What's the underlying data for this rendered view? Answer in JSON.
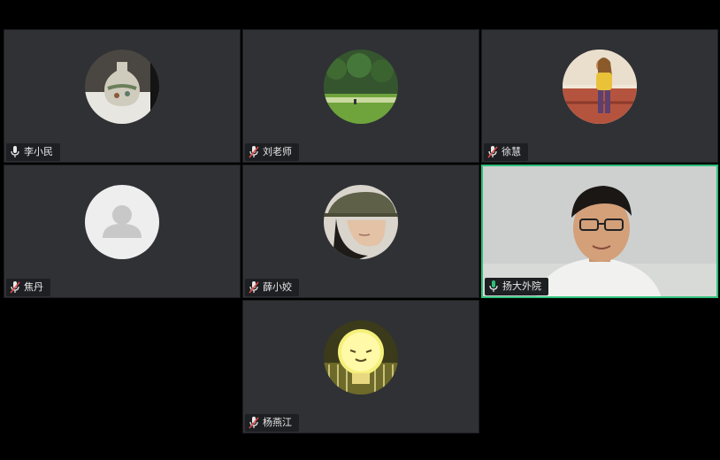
{
  "participants": [
    {
      "name": "李小民",
      "mic": "on"
    },
    {
      "name": "刘老师",
      "mic": "muted"
    },
    {
      "name": "徐慧",
      "mic": "muted"
    },
    {
      "name": "焦丹",
      "mic": "muted"
    },
    {
      "name": "薛小姣",
      "mic": "muted"
    },
    {
      "name": "扬大外院",
      "mic": "active"
    },
    {
      "name": "杨燕江",
      "mic": "muted"
    }
  ],
  "colors": {
    "tile_bg": "#2f3135",
    "active_border": "#2ec07a",
    "muted_icon": "#e04b4b",
    "mic_icon": "#e9e9e9"
  }
}
